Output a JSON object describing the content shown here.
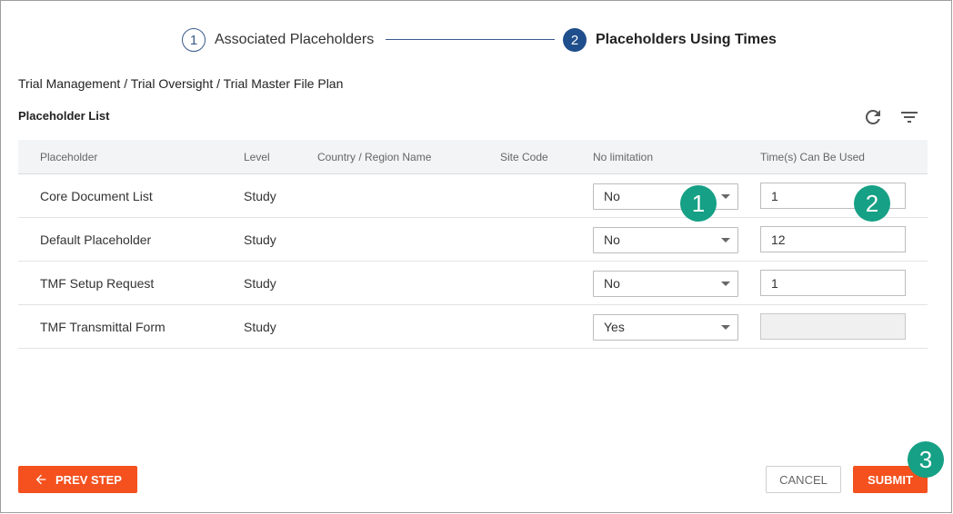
{
  "stepper": {
    "steps": [
      {
        "number": "1",
        "label": "Associated Placeholders",
        "state": "completed"
      },
      {
        "number": "2",
        "label": "Placeholders Using Times",
        "state": "active"
      }
    ]
  },
  "breadcrumb": "Trial Management / Trial Oversight / Trial Master File Plan",
  "list": {
    "title": "Placeholder List",
    "toolbar": {
      "refresh_icon": "refresh-icon",
      "filter_icon": "filter-icon"
    }
  },
  "table": {
    "headers": [
      "Placeholder",
      "Level",
      "Country / Region Name",
      "Site Code",
      "No limitation",
      "Time(s) Can Be Used"
    ],
    "rows": [
      {
        "placeholder": "Core Document List",
        "level": "Study",
        "country": "",
        "site": "",
        "no_limitation": "No",
        "times": "1",
        "times_disabled": false
      },
      {
        "placeholder": "Default Placeholder",
        "level": "Study",
        "country": "",
        "site": "",
        "no_limitation": "No",
        "times": "12",
        "times_disabled": false
      },
      {
        "placeholder": "TMF Setup Request",
        "level": "Study",
        "country": "",
        "site": "",
        "no_limitation": "No",
        "times": "1",
        "times_disabled": false
      },
      {
        "placeholder": "TMF Transmittal Form",
        "level": "Study",
        "country": "",
        "site": "",
        "no_limitation": "Yes",
        "times": "",
        "times_disabled": true
      }
    ]
  },
  "callouts": [
    "1",
    "2",
    "3"
  ],
  "buttons": {
    "prev_step": "PREV STEP",
    "cancel": "CANCEL",
    "submit": "SUBMIT"
  },
  "colors": {
    "primary": "#f4511e",
    "step_active": "#1f4e8c",
    "callout": "#16a085"
  }
}
